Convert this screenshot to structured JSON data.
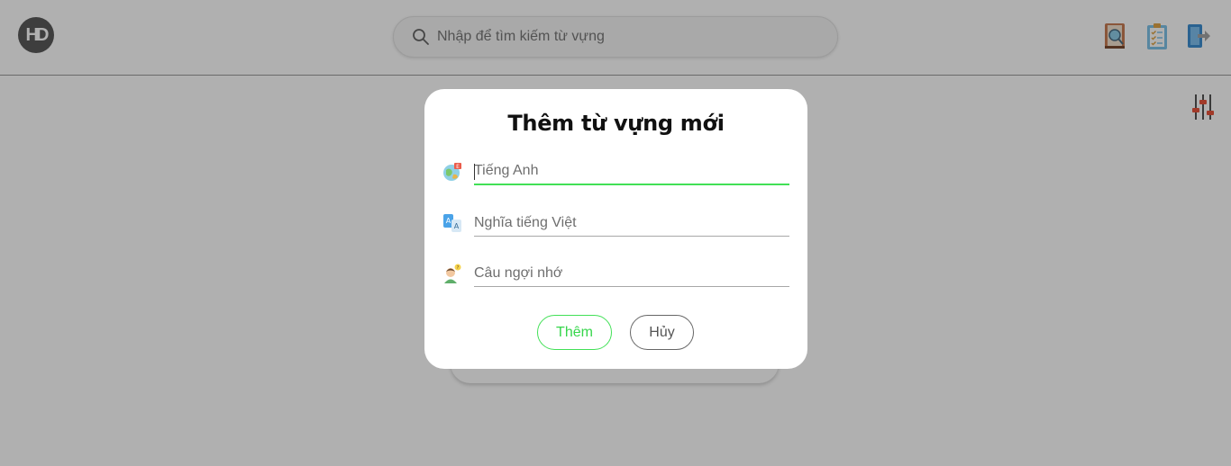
{
  "app": {
    "logo_text": "HD"
  },
  "header": {
    "search": {
      "placeholder": "Nhập để tìm kiếm từ vựng",
      "icon": "search-icon"
    },
    "icons": [
      "dictionary-icon",
      "checklist-icon",
      "logout-icon"
    ]
  },
  "toolbar": {
    "filter_icon": "sliders-icon"
  },
  "modal": {
    "title": "Thêm từ vựng mới",
    "fields": [
      {
        "icon": "globe-language-icon",
        "placeholder": "Tiếng Anh",
        "value": "",
        "focused": true
      },
      {
        "icon": "translate-icon",
        "placeholder": "Nghĩa tiếng Việt",
        "value": ""
      },
      {
        "icon": "thinking-person-icon",
        "placeholder": "Câu ngợi nhớ",
        "value": ""
      }
    ],
    "buttons": {
      "add_label": "Thêm",
      "cancel_label": "Hủy"
    }
  },
  "colors": {
    "accent_green": "#41e056",
    "overlay": "rgba(0,0,0,0.31)"
  }
}
